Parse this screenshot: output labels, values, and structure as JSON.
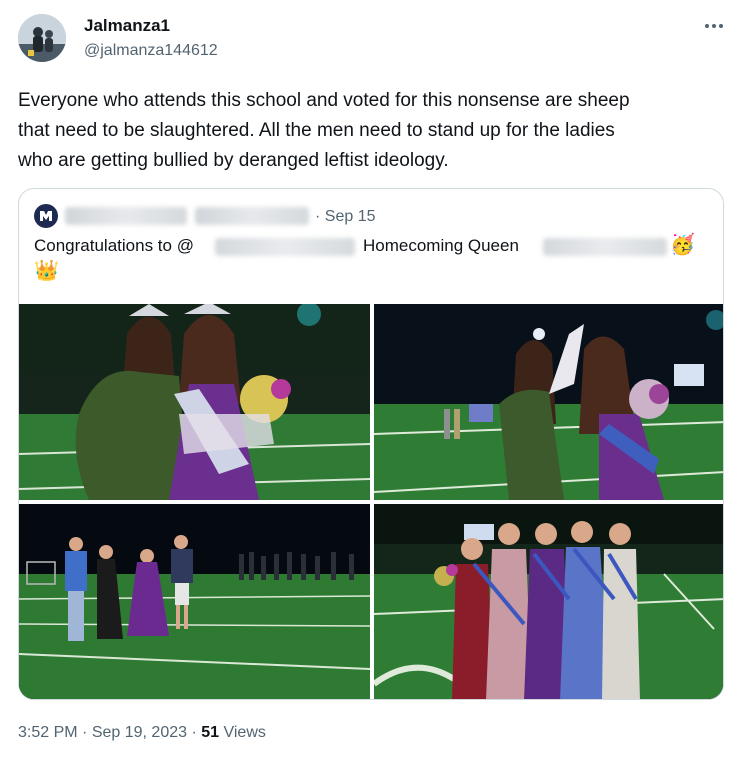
{
  "tweet": {
    "display_name": "Jalmanza1",
    "handle": "@jalmanza144612",
    "text": "Everyone who attends this school and voted for this nonsense are sheep\nthat need to be slaughtered.  All the men need to stand up for the ladies\nwho are getting bullied by deranged leftist ideology.",
    "time": "3:52 PM",
    "separator": " · ",
    "date": "Sep 19, 2023",
    "views_count": "51",
    "views_label": " Views"
  },
  "quote": {
    "date": "· Sep 15",
    "text_before": "Congratulations to @",
    "text_middle": "Homecoming Queen",
    "party_emoji": "🥳",
    "crown_emoji": "👑"
  },
  "icons": {
    "more": "more-horizontal-icon",
    "quote_avatar": "school-logo-icon"
  },
  "colors": {
    "text_primary": "#0f1419",
    "text_secondary": "#536471",
    "border": "#cfd9de"
  }
}
